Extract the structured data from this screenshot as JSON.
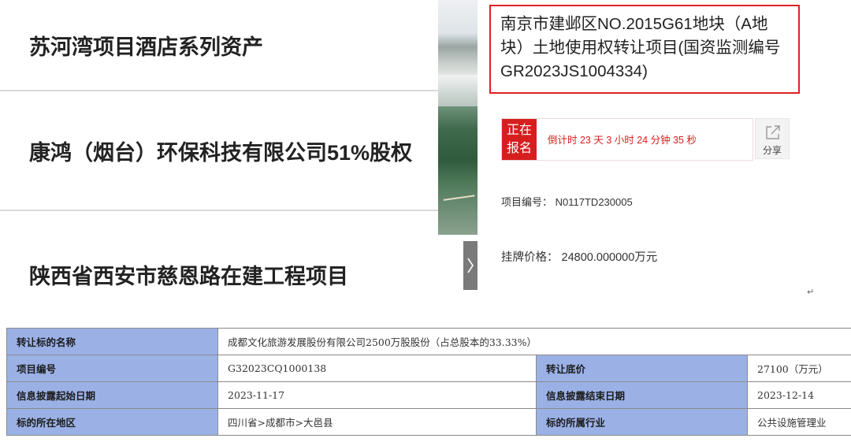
{
  "left_list": {
    "items": [
      {
        "title": "苏河湾项目酒店系列资产"
      },
      {
        "title": "康鸿（烟台）环保科技有限公司51%股权"
      },
      {
        "title": "陕西省西安市慈恩路在建工程项目"
      }
    ]
  },
  "project": {
    "title": "南京市建邺区NO.2015G61地块（A地块）土地使用权转让项目(国资监测编号GR2023JS1004334)",
    "status": "正在报名",
    "countdown": "倒计时 23 天 3 小时 24 分钟 35 秒",
    "share_label": "分享",
    "number_label": "项目编号：",
    "number_value": "N0117TD230005",
    "price_label": "挂牌价格：",
    "price_value": "24800.000000万元",
    "return_mark": "↵"
  },
  "detail_table": {
    "rows": [
      {
        "label1": "转让标的名称",
        "value1": "成都文化旅游发展股份有限公司2500万股股份（占总股本的33.33%）"
      },
      {
        "label1": "项目编号",
        "value1": "G32023CQ1000138",
        "label2": "转让底价",
        "value2": "27100（万元）"
      },
      {
        "label1": "信息披露起始日期",
        "value1": "2023-11-17",
        "label2": "信息披露结束日期",
        "value2": "2023-12-14"
      },
      {
        "label1": "标的所在地区",
        "value1": "四川省>成都市>大邑县",
        "label2": "标的所属行业",
        "value2": "公共设施管理业"
      }
    ]
  }
}
